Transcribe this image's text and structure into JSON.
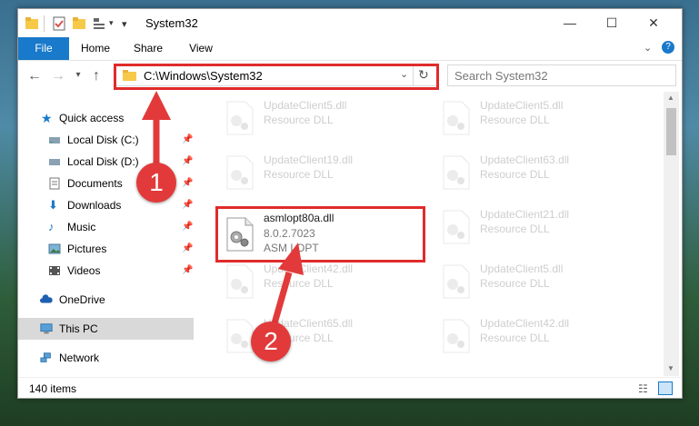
{
  "window": {
    "title": "System32"
  },
  "ribbon": {
    "tabs": [
      "File",
      "Home",
      "Share",
      "View"
    ]
  },
  "address": {
    "path": "C:\\Windows\\System32"
  },
  "search": {
    "placeholder": "Search System32"
  },
  "nav": {
    "quick_access": "Quick access",
    "items": [
      "Local Disk (C:)",
      "Local Disk (D:)",
      "Documents",
      "Downloads",
      "Music",
      "Pictures",
      "Videos"
    ],
    "onedrive": "OneDrive",
    "thispc": "This PC",
    "network": "Network"
  },
  "files": {
    "row0": {
      "left": {
        "name": "UpdateClient5.dll",
        "sub": "Resource DLL"
      },
      "right": {
        "name": "UpdateClient5.dll",
        "sub": "Resource DLL"
      }
    },
    "row1": {
      "left": {
        "name": "UpdateClient19.dll",
        "sub": "Resource DLL"
      },
      "right": {
        "name": "UpdateClient63.dll",
        "sub": "Resource DLL"
      }
    },
    "highlighted": {
      "name": "asmlopt80a.dll",
      "version": "8.0.2.7023",
      "desc": "ASM LOPT"
    },
    "row2right": {
      "name": "UpdateClient21.dll",
      "sub": "Resource DLL"
    },
    "row3": {
      "left": {
        "name": "UpdateClient42.dll",
        "sub": "Resource DLL"
      },
      "right": {
        "name": "UpdateClient5.dll",
        "sub": "Resource DLL"
      }
    },
    "row4": {
      "left": {
        "name": "UpdateClient65.dll",
        "sub": "Resource DLL"
      },
      "right": {
        "name": "UpdateClient42.dll",
        "sub": "Resource DLL"
      }
    }
  },
  "status": {
    "count": "140 items"
  },
  "annotations": {
    "step1": "1",
    "step2": "2"
  },
  "colors": {
    "accent": "#1979ca",
    "highlight": "#e02b2b",
    "selected": "#d9d9d9"
  }
}
